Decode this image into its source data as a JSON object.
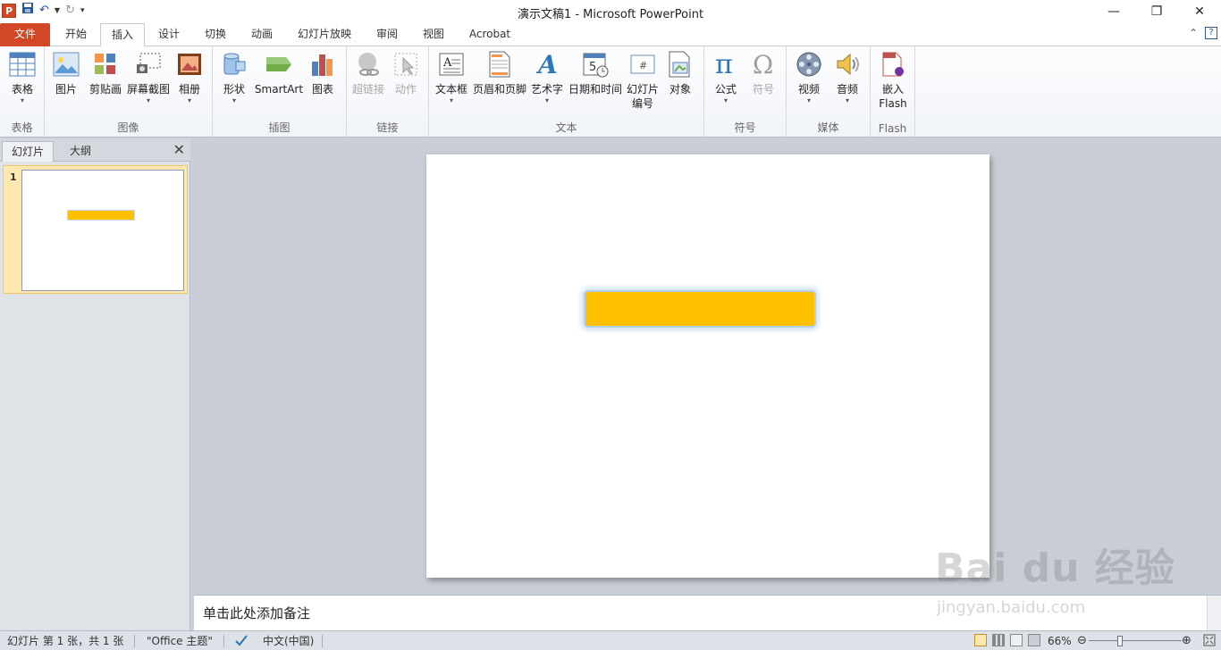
{
  "window": {
    "title": "演示文稿1  -  Microsoft PowerPoint",
    "controls": [
      "—",
      "❐",
      "✕"
    ]
  },
  "menu": {
    "file": "文件",
    "tabs": [
      "开始",
      "插入",
      "设计",
      "切换",
      "动画",
      "幻灯片放映",
      "审阅",
      "视图",
      "Acrobat"
    ],
    "active_tab": "插入"
  },
  "ribbon": {
    "groups": {
      "table": "表格",
      "images": "图像",
      "illustrations": "插图",
      "links": "链接",
      "text": "文本",
      "symbols": "符号",
      "media": "媒体",
      "flash": "Flash"
    },
    "buttons": {
      "table": "表格",
      "picture": "图片",
      "clipart": "剪贴画",
      "screenshot": "屏幕截图",
      "album": "相册",
      "shapes": "形状",
      "smartart": "SmartArt",
      "chart": "图表",
      "hyperlink": "超链接",
      "action": "动作",
      "textbox": "文本框",
      "header_footer": "页眉和页脚",
      "wordart": "艺术字",
      "datetime": "日期和时间",
      "slide_number_1": "幻灯片",
      "slide_number_2": "编号",
      "object": "对象",
      "equation": "公式",
      "symbol": "符号",
      "video": "视频",
      "audio": "音频",
      "embed_flash_1": "嵌入",
      "embed_flash_2": "Flash"
    }
  },
  "left_panel": {
    "tab_slides": "幻灯片",
    "tab_outline": "大纲",
    "slide_number": "1"
  },
  "notes": {
    "placeholder": "单击此处添加备注"
  },
  "status": {
    "slide_info": "幻灯片 第 1 张，共 1 张",
    "theme": "\"Office 主题\"",
    "language": "中文(中国)",
    "zoom": "66%"
  },
  "watermark": {
    "text": "Bai du 经验",
    "sub": "jingyan.baidu.com"
  },
  "colors": {
    "file_tab": "#d24726",
    "shape_fill": "#ffc000",
    "shape_glow": "#b4cfeb"
  }
}
